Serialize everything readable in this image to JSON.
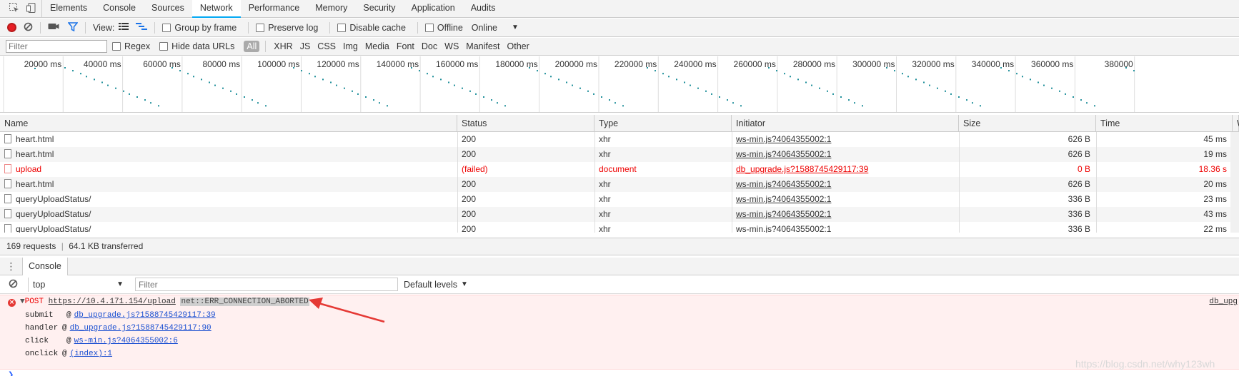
{
  "tabs": [
    "Elements",
    "Console",
    "Sources",
    "Network",
    "Performance",
    "Memory",
    "Security",
    "Application",
    "Audits"
  ],
  "toolbar": {
    "view_label": "View:",
    "group_by_frame": "Group by frame",
    "preserve_log": "Preserve log",
    "disable_cache": "Disable cache",
    "offline": "Offline",
    "throttle": "Online"
  },
  "filterbar": {
    "placeholder": "Filter",
    "regex": "Regex",
    "hide_data_urls": "Hide data URLs",
    "types": [
      "All",
      "XHR",
      "JS",
      "CSS",
      "Img",
      "Media",
      "Font",
      "Doc",
      "WS",
      "Manifest",
      "Other"
    ]
  },
  "overview": {
    "ticks": [
      "20000 ms",
      "40000 ms",
      "60000 ms",
      "80000 ms",
      "100000 ms",
      "120000 ms",
      "140000 ms",
      "160000 ms",
      "180000 ms",
      "200000 ms",
      "220000 ms",
      "240000 ms",
      "260000 ms",
      "280000 ms",
      "300000 ms",
      "320000 ms",
      "340000 ms",
      "360000 ms",
      "380000"
    ]
  },
  "grid": {
    "columns": [
      "Name",
      "Status",
      "Type",
      "Initiator",
      "Size",
      "Time",
      "W"
    ],
    "rows": [
      {
        "name": "heart.html",
        "status": "200",
        "type": "xhr",
        "initiator": "ws-min.js?4064355002:1",
        "size": "626 B",
        "time": "45 ms",
        "failed": false
      },
      {
        "name": "heart.html",
        "status": "200",
        "type": "xhr",
        "initiator": "ws-min.js?4064355002:1",
        "size": "626 B",
        "time": "19 ms",
        "failed": false
      },
      {
        "name": "upload",
        "status": "(failed)",
        "type": "document",
        "initiator": "db_upgrade.js?1588745429117:39",
        "size": "0 B",
        "time": "18.36 s",
        "failed": true
      },
      {
        "name": "heart.html",
        "status": "200",
        "type": "xhr",
        "initiator": "ws-min.js?4064355002:1",
        "size": "626 B",
        "time": "20 ms",
        "failed": false
      },
      {
        "name": "queryUploadStatus/",
        "status": "200",
        "type": "xhr",
        "initiator": "ws-min.js?4064355002:1",
        "size": "336 B",
        "time": "23 ms",
        "failed": false
      },
      {
        "name": "queryUploadStatus/",
        "status": "200",
        "type": "xhr",
        "initiator": "ws-min.js?4064355002:1",
        "size": "336 B",
        "time": "43 ms",
        "failed": false
      },
      {
        "name": "queryUploadStatus/",
        "status": "200",
        "type": "xhr",
        "initiator": "ws-min.js?4064355002:1",
        "size": "336 B",
        "time": "22 ms",
        "failed": false
      }
    ]
  },
  "summary": {
    "requests": "169 requests",
    "divider": "|",
    "transferred": "64.1 KB transferred"
  },
  "drawer": {
    "tab": "Console"
  },
  "console_toolbar": {
    "context": "top",
    "filter_placeholder": "Filter",
    "levels": "Default levels"
  },
  "error": {
    "method": "POST",
    "url": "https://10.4.171.154/upload",
    "code": "net::ERR_CONNECTION_ABORTED",
    "source": "db_upg",
    "stack": [
      {
        "fn": "submit",
        "at": "@",
        "link": "db_upgrade.js?1588745429117:39"
      },
      {
        "fn": "handler",
        "at": "@",
        "link": "db_upgrade.js?1588745429117:90"
      },
      {
        "fn": "click",
        "at": "@",
        "link": "ws-min.js?4064355002:6"
      },
      {
        "fn": "onclick",
        "at": "@",
        "link": "(index):1"
      }
    ]
  },
  "watermark": "https://blog.csdn.net/why123wh",
  "colors": {
    "accent": "#03a9f4",
    "record": "#e81e25",
    "error": "#ee0000",
    "error_bg": "#fff0f0",
    "arrow": "#e53935"
  }
}
